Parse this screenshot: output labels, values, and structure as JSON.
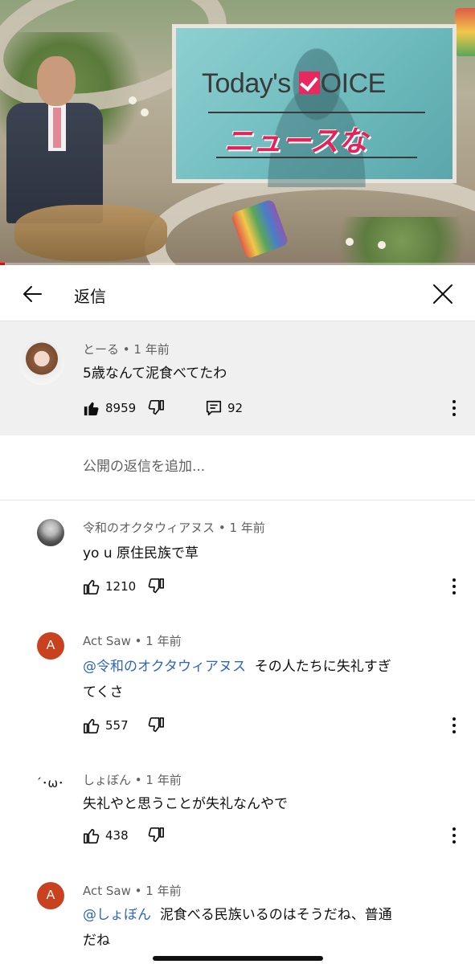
{
  "video": {
    "screen_title_pre": "Today's ",
    "screen_title_post": "OICE",
    "screen_subtitle": "ニュースな",
    "progress_percent": 1
  },
  "header": {
    "title": "返信"
  },
  "parent_comment": {
    "author": "とーる",
    "age": "1 年前",
    "text": "5歳なんて泥食べてたわ",
    "likes": "8959",
    "replies": "92"
  },
  "add_reply": {
    "placeholder": "公開の返信を追加..."
  },
  "replies": [
    {
      "author": "令和のオクタウィアヌス",
      "age": "1 年前",
      "mention": "",
      "text": "yo u 原住民族で草",
      "text_cont": "",
      "likes": "1210"
    },
    {
      "author": "Act Saw",
      "avatar_letter": "A",
      "age": "1 年前",
      "mention": "@令和のオクタウィアヌス",
      "text": "その人たちに失礼すぎ",
      "text_cont": "てくさ",
      "likes": "557"
    },
    {
      "author": "しょぼん",
      "avatar_face": "´･ω･`",
      "age": "1 年前",
      "mention": "",
      "text": "失礼やと思うことが失礼なんやで",
      "text_cont": "",
      "likes": "438"
    },
    {
      "author": "Act Saw",
      "avatar_letter": "A",
      "age": "1 年前",
      "mention": "@しょぼん",
      "text": "泥食べる民族いるのはそうだね、普通",
      "text_cont": "だね",
      "likes": ""
    }
  ],
  "separator": " • ",
  "colors": {
    "mention": "#2f63c4",
    "letter_avatar": "#c9421f",
    "progress": "#ff0000"
  },
  "icons": [
    "back-arrow-icon",
    "close-icon",
    "thumbs-up-icon",
    "thumbs-down-icon",
    "reply-icon",
    "more-vert-icon"
  ]
}
